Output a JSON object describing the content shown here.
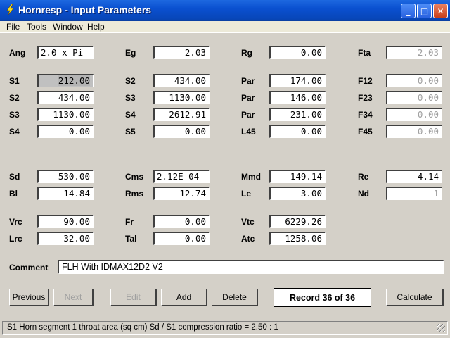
{
  "window": {
    "title": "Hornresp - Input Parameters",
    "app_icon": "lightning-bolt-icon",
    "controls": {
      "minimize": "_",
      "maximize": "□",
      "close": "✕"
    }
  },
  "menu": [
    "File",
    "Tools",
    "Window",
    "Help"
  ],
  "fields": {
    "Ang": {
      "label": "Ang",
      "value": "2.0 x Pi"
    },
    "Eg": {
      "label": "Eg",
      "value": "2.03"
    },
    "Rg": {
      "label": "Rg",
      "value": "0.00"
    },
    "Fta": {
      "label": "Fta",
      "value": "2.03"
    },
    "S1": {
      "label": "S1",
      "value": "212.00"
    },
    "S2a": {
      "label": "S2",
      "value": "434.00"
    },
    "Par1": {
      "label": "Par",
      "value": "174.00"
    },
    "F12": {
      "label": "F12",
      "value": "0.00"
    },
    "S2": {
      "label": "S2",
      "value": "434.00"
    },
    "S3a": {
      "label": "S3",
      "value": "1130.00"
    },
    "Par2": {
      "label": "Par",
      "value": "146.00"
    },
    "F23": {
      "label": "F23",
      "value": "0.00"
    },
    "S3": {
      "label": "S3",
      "value": "1130.00"
    },
    "S4a": {
      "label": "S4",
      "value": "2612.91"
    },
    "Par3": {
      "label": "Par",
      "value": "231.00"
    },
    "F34": {
      "label": "F34",
      "value": "0.00"
    },
    "S4": {
      "label": "S4",
      "value": "0.00"
    },
    "S5": {
      "label": "S5",
      "value": "0.00"
    },
    "L45": {
      "label": "L45",
      "value": "0.00"
    },
    "F45": {
      "label": "F45",
      "value": "0.00"
    },
    "Sd": {
      "label": "Sd",
      "value": "530.00"
    },
    "Cms": {
      "label": "Cms",
      "value": "2.12E-04"
    },
    "Mmd": {
      "label": "Mmd",
      "value": "149.14"
    },
    "Re": {
      "label": "Re",
      "value": "4.14"
    },
    "Bl": {
      "label": "Bl",
      "value": "14.84"
    },
    "Rms": {
      "label": "Rms",
      "value": "12.74"
    },
    "Le": {
      "label": "Le",
      "value": "3.00"
    },
    "Nd": {
      "label": "Nd",
      "value": "1"
    },
    "Vrc": {
      "label": "Vrc",
      "value": "90.00"
    },
    "Fr": {
      "label": "Fr",
      "value": "0.00"
    },
    "Vtc": {
      "label": "Vtc",
      "value": "6229.26"
    },
    "Lrc": {
      "label": "Lrc",
      "value": "32.00"
    },
    "Tal": {
      "label": "Tal",
      "value": "0.00"
    },
    "Atc": {
      "label": "Atc",
      "value": "1258.06"
    }
  },
  "comment": {
    "label": "Comment",
    "value": "FLH With IDMAX12D2 V2"
  },
  "buttons": {
    "previous": "Previous",
    "next": "Next",
    "edit": "Edit",
    "add": "Add",
    "delete": "Delete",
    "calculate": "Calculate"
  },
  "record": "Record 36 of 36",
  "status": "S1   Horn segment 1 throat area  (sq cm)   Sd / S1 compression ratio = 2.50 : 1"
}
